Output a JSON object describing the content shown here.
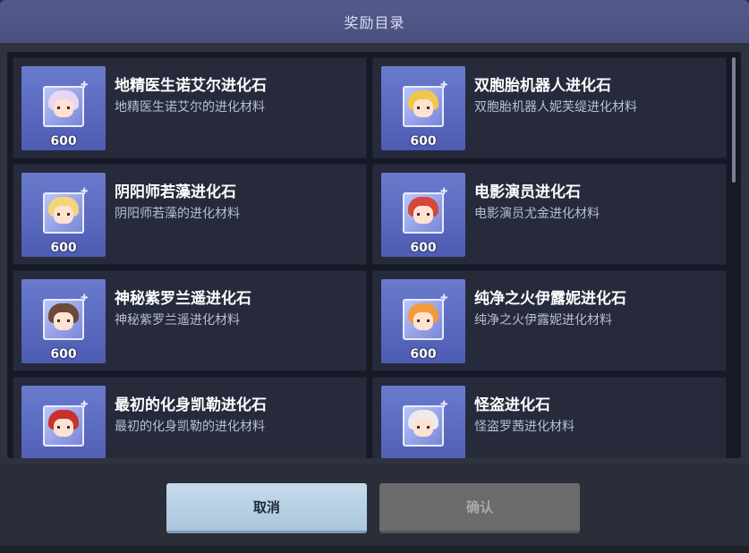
{
  "dialog": {
    "title": "奖励目录",
    "items": [
      {
        "name": "地精医生诺艾尔进化石",
        "desc": "地精医生诺艾尔的进化材料",
        "count": "600",
        "hair": "#e9d6f2",
        "icon": "portrait-icon"
      },
      {
        "name": "双胞胎机器人进化石",
        "desc": "双胞胎机器人妮芙缇进化材料",
        "count": "600",
        "hair": "#f2c64a",
        "icon": "portrait-icon"
      },
      {
        "name": "阴阳师若藻进化石",
        "desc": "阴阳师若藻的进化材料",
        "count": "600",
        "hair": "#f4d47a",
        "icon": "portrait-icon"
      },
      {
        "name": "电影演员进化石",
        "desc": "电影演员尤金进化材料",
        "count": "600",
        "hair": "#d4473a",
        "icon": "portrait-icon"
      },
      {
        "name": "神秘紫罗兰遥进化石",
        "desc": "神秘紫罗兰遥进化材料",
        "count": "600",
        "hair": "#6b4a3c",
        "icon": "portrait-icon"
      },
      {
        "name": "纯净之火伊露妮进化石",
        "desc": "纯净之火伊露妮进化材料",
        "count": "600",
        "hair": "#f39a3a",
        "icon": "portrait-icon"
      },
      {
        "name": "最初的化身凯勒进化石",
        "desc": "最初的化身凯勒的进化材料",
        "count": "",
        "hair": "#c8322a",
        "icon": "portrait-icon"
      },
      {
        "name": "怪盗进化石",
        "desc": "怪盗罗茜进化材料",
        "count": "",
        "hair": "#efe9ec",
        "icon": "portrait-icon"
      }
    ]
  },
  "footer": {
    "cancel_label": "取消",
    "confirm_label": "确认"
  }
}
